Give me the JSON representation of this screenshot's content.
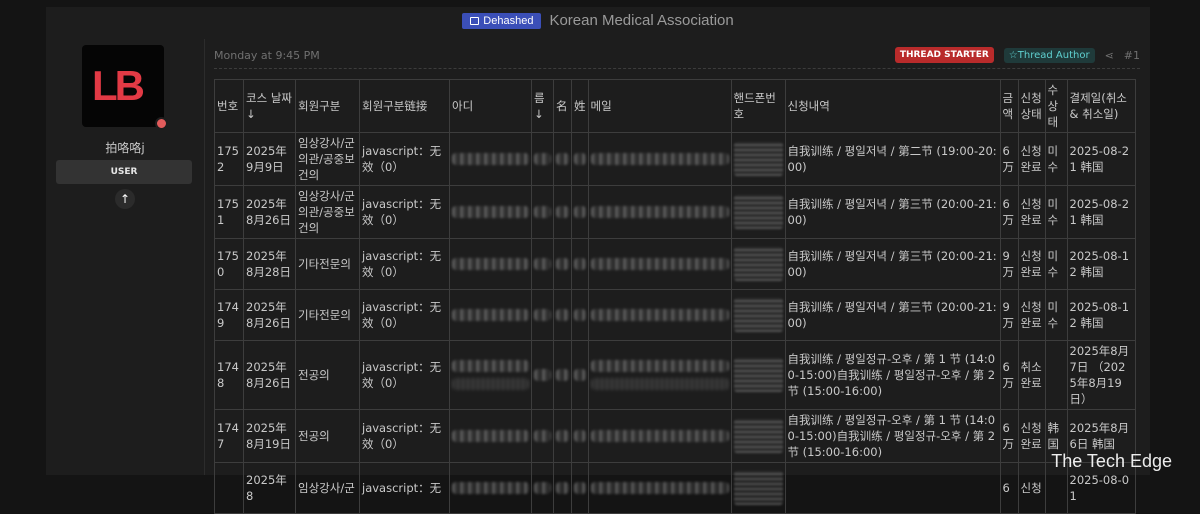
{
  "header": {
    "badge_label": "Dehashed",
    "site_title": "Korean Medical Association"
  },
  "user": {
    "avatar_text": "LB",
    "username": "拍咯咯j",
    "role": "USER",
    "up_icon": "arrow-up-icon"
  },
  "post": {
    "timestamp": "Monday at 9:45 PM",
    "starter_badge": "THREAD STARTER",
    "author_badge": "☆Thread Author",
    "share_icon": "share-icon",
    "post_number": "#1"
  },
  "table": {
    "headers": [
      "번호",
      "코스 날짜 ↓",
      "회원구분",
      "회원구분链接",
      "아디",
      "름↓",
      "名",
      "姓",
      "메일",
      "핸드폰번호",
      "신청내역",
      "금액",
      "신청상태",
      "수상태",
      "결제일(취소 & 취소일)"
    ],
    "rows": [
      {
        "no": "1752",
        "date": "2025年9月9日",
        "member": "임상강사/군의관/공중보건의",
        "link": "javascript：无效（0）",
        "detail": "自我训练 / 평일저녁 / 第二节 (19:00-20:00)",
        "amount": "6万",
        "status": "신청완료",
        "pay": "미수",
        "paydate": "2025-08-21 韩国"
      },
      {
        "no": "1751",
        "date": "2025年8月26日",
        "member": "임상강사/군의관/공중보건의",
        "link": "javascript：无效（0）",
        "detail": "自我训练 / 평일저녁 / 第三节 (20:00-21:00)",
        "amount": "6万",
        "status": "신청완료",
        "pay": "미수",
        "paydate": "2025-08-21 韩国"
      },
      {
        "no": "1750",
        "date": "2025年8月28日",
        "member": "기타전문의",
        "link": "javascript：无效（0）",
        "detail": "自我训练 / 평일저녁 / 第三节 (20:00-21:00)",
        "amount": "9万",
        "status": "신청완료",
        "pay": "미수",
        "paydate": "2025-08-12 韩国"
      },
      {
        "no": "1749",
        "date": "2025年8月26日",
        "member": "기타전문의",
        "link": "javascript：无效（0）",
        "detail": "自我训练 / 평일저녁 / 第三节 (20:00-21:00)",
        "amount": "9万",
        "status": "신청완료",
        "pay": "미수",
        "paydate": "2025-08-12 韩国"
      },
      {
        "no": "1748",
        "date": "2025年8月26日",
        "member": "전공의",
        "link": "javascript：无效（0）",
        "detail": "自我训练 / 평일정규-오후 / 第 1 节 (14:00-15:00)自我训练 / 평일정규-오후 / 第 2 节 (15:00-16:00)",
        "amount": "6万",
        "status": "취소완료",
        "pay": "",
        "paydate": "2025年8月7日 （2025年8月19日）"
      },
      {
        "no": "1747",
        "date": "2025年8月19日",
        "member": "전공의",
        "link": "javascript：无效（0）",
        "detail": "自我训练 / 평일정규-오후 / 第 1 节 (14:00-15:00)自我训练 / 평일정규-오후 / 第 2 节 (15:00-16:00)",
        "amount": "6万",
        "status": "신청완료",
        "pay": "韩国",
        "paydate": "2025年8月6日 韩国"
      },
      {
        "no": "",
        "date": "2025年8",
        "member": "임상강사/군",
        "link": "javascript：无",
        "detail": "",
        "amount": "6",
        "status": "신청",
        "pay": "",
        "paydate": "2025-08-01"
      }
    ]
  },
  "watermark": "The Tech Edge"
}
